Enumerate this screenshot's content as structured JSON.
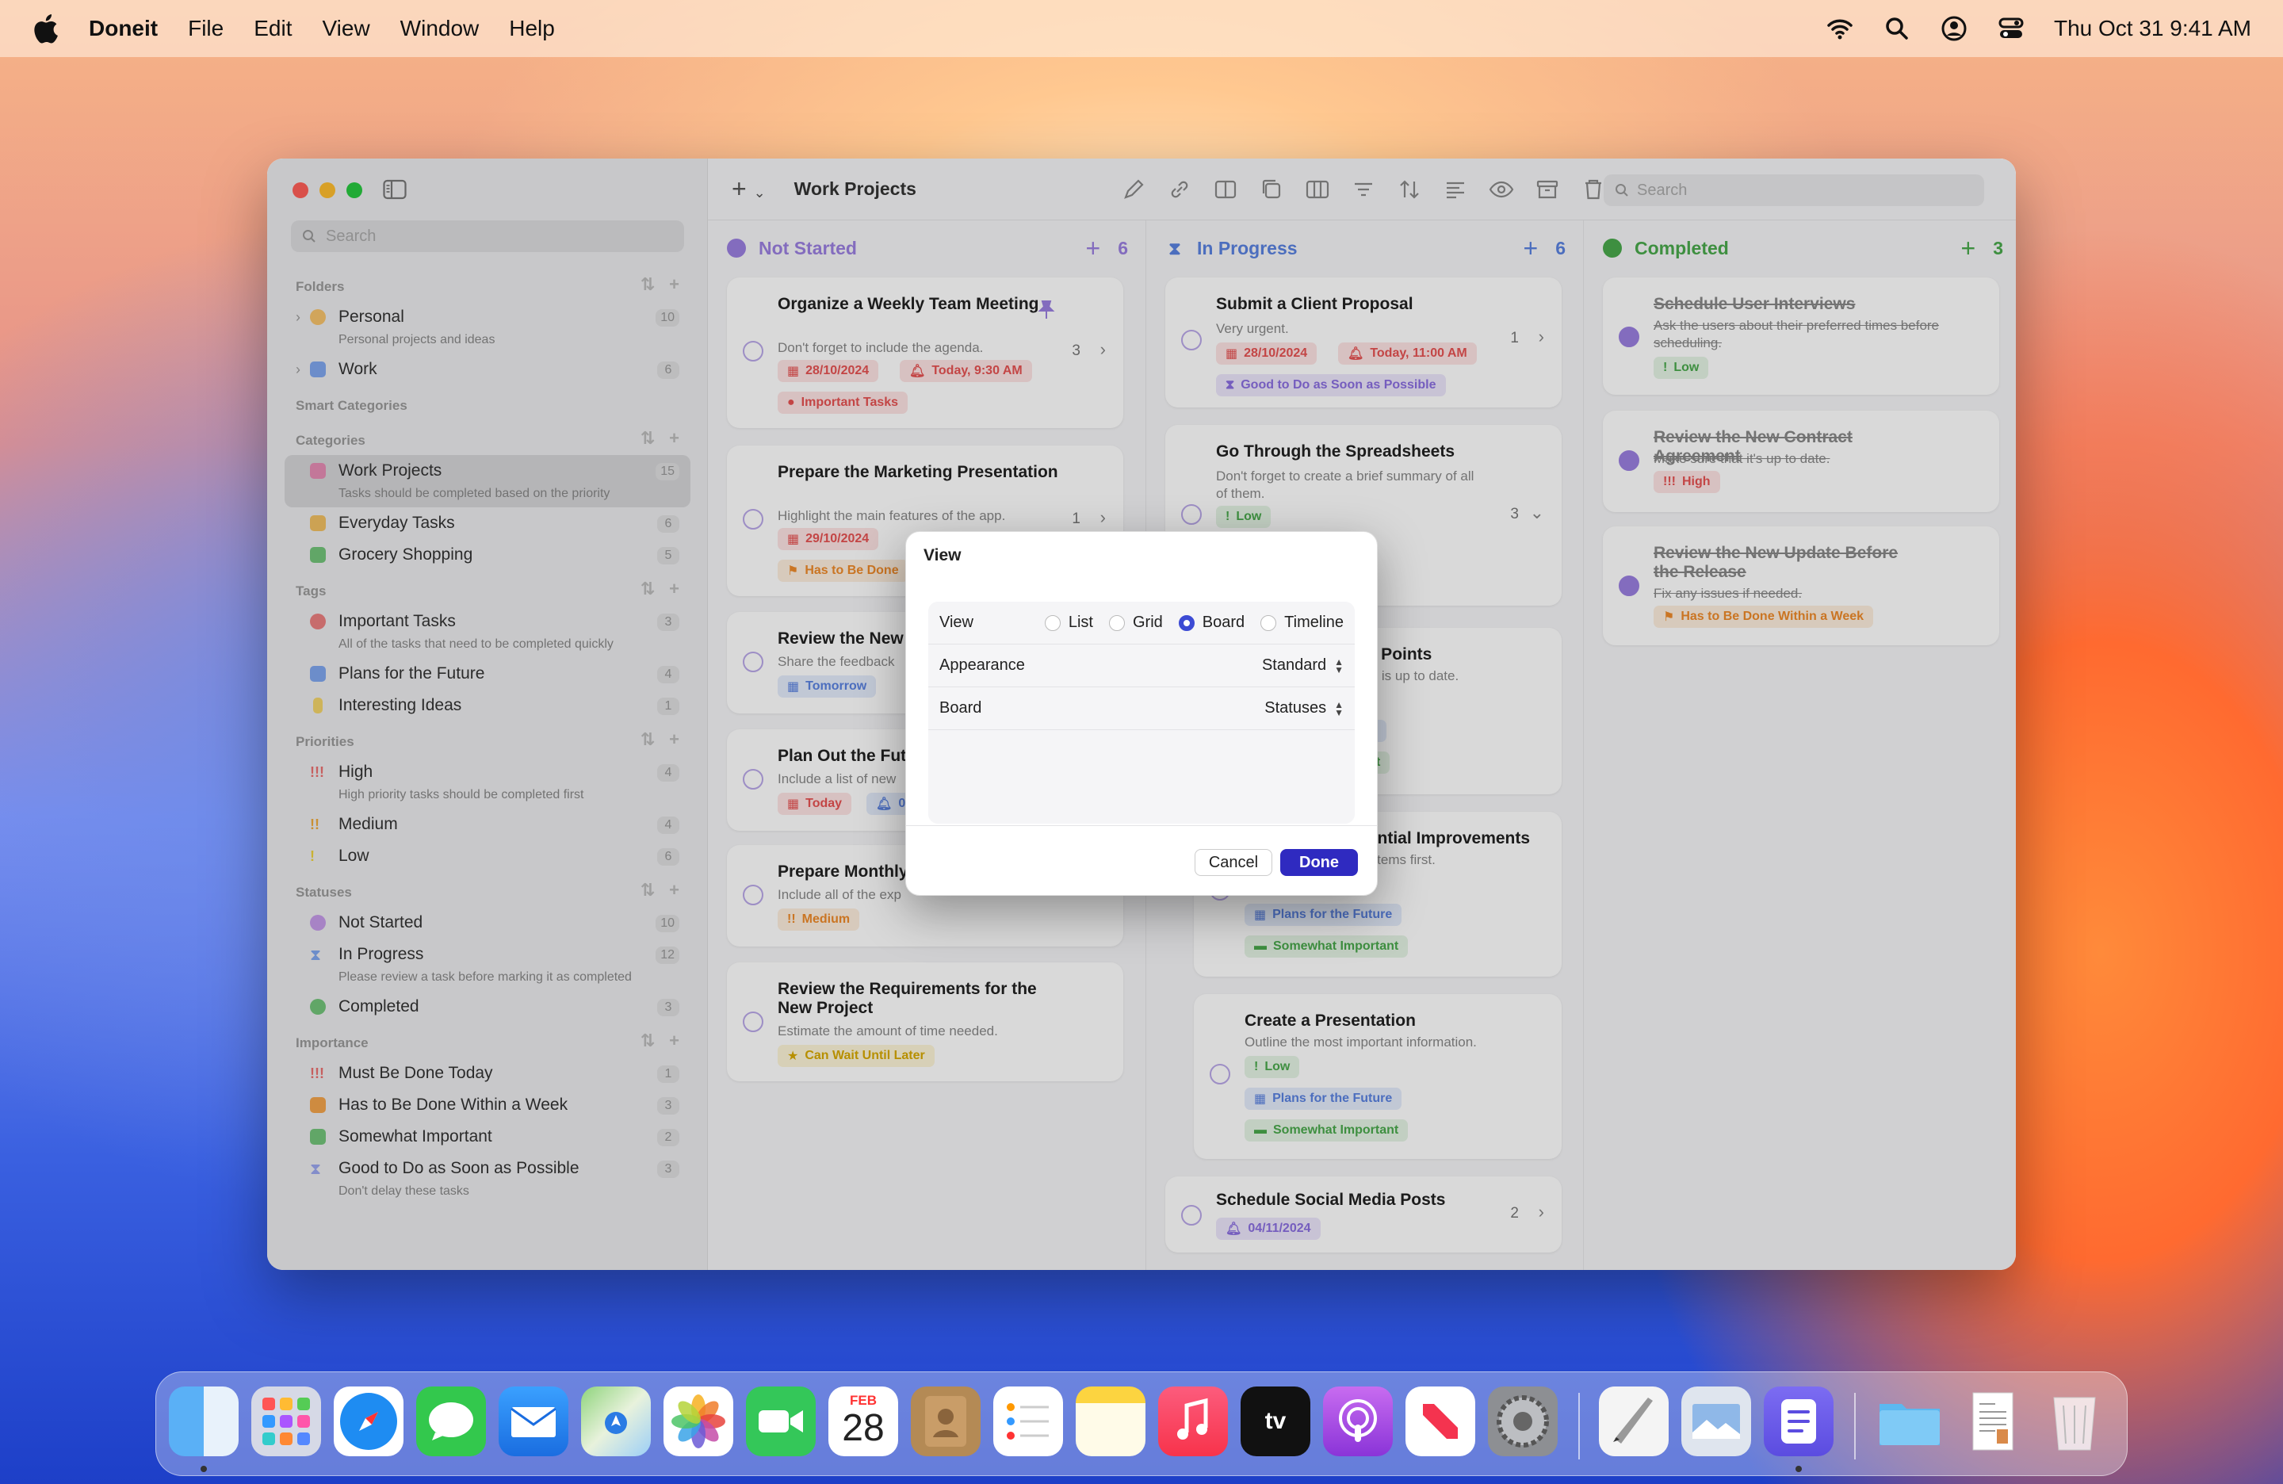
{
  "menubar": {
    "app": "Doneit",
    "menus": [
      "File",
      "Edit",
      "View",
      "Window",
      "Help"
    ],
    "clock": "Thu Oct 31  9:41 AM"
  },
  "sidebar": {
    "search_placeholder": "Search",
    "sections": {
      "folders": "Folders",
      "smart": "Smart Categories",
      "categories": "Categories",
      "tags": "Tags",
      "priorities": "Priorities",
      "statuses": "Statuses",
      "importance": "Importance"
    },
    "folders": [
      {
        "name": "Personal",
        "sub": "Personal projects and ideas",
        "count": "10"
      },
      {
        "name": "Work",
        "sub": "",
        "count": "6"
      }
    ],
    "categories": [
      {
        "name": "Work Projects",
        "sub": "Tasks should be completed based on the priority",
        "count": "15"
      },
      {
        "name": "Everyday Tasks",
        "sub": "",
        "count": "6"
      },
      {
        "name": "Grocery Shopping",
        "sub": "",
        "count": "5"
      }
    ],
    "tags": [
      {
        "name": "Important Tasks",
        "sub": "All of the tasks that need to be completed quickly",
        "count": "3"
      },
      {
        "name": "Plans for the Future",
        "sub": "",
        "count": "4"
      },
      {
        "name": "Interesting Ideas",
        "sub": "",
        "count": "1"
      }
    ],
    "priorities": [
      {
        "name": "High",
        "sub": "High priority tasks should be completed first",
        "count": "4"
      },
      {
        "name": "Medium",
        "sub": "",
        "count": "4"
      },
      {
        "name": "Low",
        "sub": "",
        "count": "6"
      }
    ],
    "statuses": [
      {
        "name": "Not Started",
        "sub": "",
        "count": "10"
      },
      {
        "name": "In Progress",
        "sub": "Please review a task before marking it as completed",
        "count": "12"
      },
      {
        "name": "Completed",
        "sub": "",
        "count": "3"
      }
    ],
    "importance": [
      {
        "name": "Must Be Done Today",
        "sub": "",
        "count": "1"
      },
      {
        "name": "Has to Be Done Within a Week",
        "sub": "",
        "count": "3"
      },
      {
        "name": "Somewhat Important",
        "sub": "",
        "count": "2"
      },
      {
        "name": "Good to Do as Soon as Possible",
        "sub": "Don't delay these tasks",
        "count": "3"
      }
    ]
  },
  "toolbar": {
    "title": "Work Projects",
    "search_placeholder": "Search"
  },
  "columns": {
    "not_started": {
      "title": "Not Started",
      "count": "6",
      "color": "#9b7fe0"
    },
    "in_progress": {
      "title": "In Progress",
      "count": "6",
      "color": "#5a82e0"
    },
    "completed": {
      "title": "Completed",
      "count": "3",
      "color": "#49a94c"
    }
  },
  "cards_ns": [
    {
      "title": "Organize a Weekly Team Meeting",
      "desc": "Don't forget to include the agenda.",
      "tags": [
        "28/10/2024",
        "Today, 9:30 AM",
        "Important Tasks"
      ],
      "num": "3"
    },
    {
      "title": "Prepare the Marketing Presentation",
      "desc": "Highlight the main features of the app.",
      "tags": [
        "29/10/2024",
        "Has to Be Done"
      ],
      "num": "1"
    },
    {
      "title": "Review the New V",
      "desc": "Share the feedback",
      "tags": [
        "Tomorrow"
      ]
    },
    {
      "title": "Plan Out the Futu",
      "desc": "Include a list of new",
      "tags": [
        "Today",
        "07"
      ]
    },
    {
      "title": "Prepare Monthly",
      "desc": "Include all of the exp",
      "tags": [
        "Medium"
      ]
    },
    {
      "title": "Review the Requirements for the New Project",
      "desc": "Estimate the amount of time needed.",
      "tags": [
        "Can Wait Until Later"
      ]
    }
  ],
  "cards_ip": [
    {
      "title": "Submit a Client Proposal",
      "desc": "Very urgent.",
      "tags": [
        "28/10/2024",
        "Today, 11:00 AM",
        "Good to Do as Soon as Possible"
      ],
      "num": "1"
    },
    {
      "title": "Go Through the Spreadsheets",
      "desc": "Don't forget to create a brief summary of all of them.",
      "tags": [
        "Low"
      ],
      "num": "3"
    },
    {
      "title": "ata Points",
      "desc": "hing is up to date.",
      "tags": [
        "ure",
        "tant"
      ]
    },
    {
      "title": "otential Improvements",
      "desc": "rity items first.",
      "tags": [
        "Plans for the Future",
        "Somewhat Important"
      ]
    },
    {
      "title": "Create a Presentation",
      "desc": "Outline the most important information.",
      "tags": [
        "Low",
        "Plans for the Future",
        "Somewhat Important"
      ]
    },
    {
      "title": "Schedule Social Media Posts",
      "desc": "",
      "tags": [
        "04/11/2024"
      ],
      "num": "2"
    }
  ],
  "cards_c": [
    {
      "title": "Schedule User Interviews",
      "desc": "Ask the users about their preferred times before scheduling.",
      "tags": [
        "Low"
      ]
    },
    {
      "title": "Review the New Contract Agreement",
      "desc": "Make sure that it's up to date.",
      "tags": [
        "High"
      ]
    },
    {
      "title": "Review the New Update Before the Release",
      "desc": "Fix any issues if needed.",
      "tags": [
        "Has to Be Done Within a Week"
      ]
    }
  ],
  "dialog": {
    "title": "View",
    "view_label": "View",
    "options": [
      "List",
      "Grid",
      "Board",
      "Timeline"
    ],
    "selected": "Board",
    "appearance_label": "Appearance",
    "appearance_value": "Standard",
    "board_label": "Board",
    "board_value": "Statuses",
    "cancel": "Cancel",
    "done": "Done"
  },
  "dock": {
    "calendar_month": "FEB",
    "calendar_day": "28"
  }
}
